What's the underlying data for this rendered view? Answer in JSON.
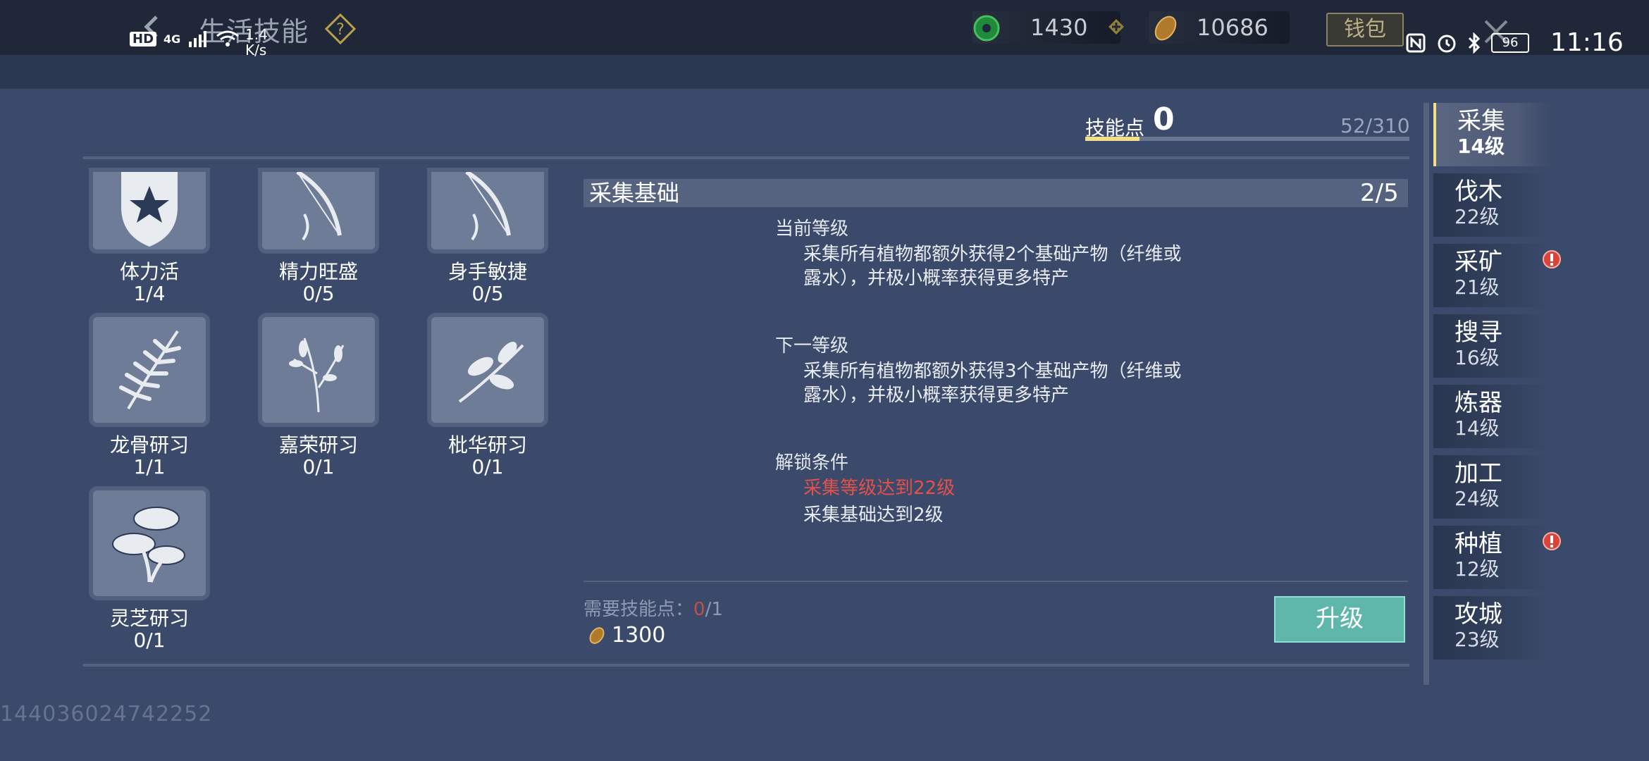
{
  "header": {
    "title": "生活技能",
    "currency_jade": "1430",
    "currency_gold": "10686",
    "wallet_label": "钱包"
  },
  "status_bar": {
    "hd": "HD",
    "network": "4G",
    "speed_value": "1.4",
    "speed_unit": "K/s",
    "battery": "96",
    "time": "11:16"
  },
  "skill_points": {
    "label": "技能点",
    "value": "0",
    "progress_text": "52/310",
    "progress_fraction": 0.168
  },
  "skills": [
    {
      "name": "体力活",
      "level": "1/4"
    },
    {
      "name": "精力旺盛",
      "level": "0/5"
    },
    {
      "name": "身手敏捷",
      "level": "0/5"
    },
    {
      "name": "龙骨研习",
      "level": "1/1"
    },
    {
      "name": "嘉荣研习",
      "level": "0/1"
    },
    {
      "name": "枇华研习",
      "level": "0/1"
    },
    {
      "name": "灵芝研习",
      "level": "0/1"
    }
  ],
  "detail": {
    "title": "采集基础",
    "progress": "2/5",
    "current_label": "当前等级",
    "current_text": "采集所有植物都额外获得2个基础产物（纤维或露水），并极小概率获得更多特产",
    "next_label": "下一等级",
    "next_text": "采集所有植物都额外获得3个基础产物（纤维或露水），并极小概率获得更多特产",
    "unlock_label": "解锁条件",
    "unlock_cond_1": "采集等级达到22级",
    "unlock_cond_2": "采集基础达到2级",
    "cost_label": "需要技能点：",
    "cost_have": "0",
    "cost_need": "/1",
    "gold_cost": "1300",
    "upgrade_label": "升级"
  },
  "tabs": [
    {
      "name": "采集",
      "level": "14级"
    },
    {
      "name": "伐木",
      "level": "22级"
    },
    {
      "name": "采矿",
      "level": "21级"
    },
    {
      "name": "搜寻",
      "level": "16级"
    },
    {
      "name": "炼器",
      "level": "14级"
    },
    {
      "name": "加工",
      "level": "24级"
    },
    {
      "name": "种植",
      "level": "12级"
    },
    {
      "name": "攻城",
      "level": "23级"
    }
  ],
  "watermark": "144036024742252",
  "colors": {
    "background": "#3b4a6a",
    "accent_gold": "#f2df8a",
    "alert_red": "#e4504a",
    "button_teal": "#5fb6ab"
  }
}
